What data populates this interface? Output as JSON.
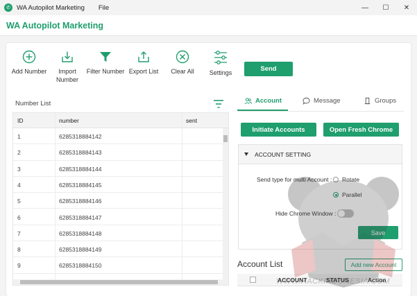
{
  "titlebar": {
    "app_title": "WA Autopilot Marketing",
    "menu_file": "File",
    "minimize": "—",
    "maximize": "☐",
    "close": "✕"
  },
  "header": {
    "title": "WA Autopilot Marketing"
  },
  "toolbar": {
    "add_number": "Add Number",
    "import_number": "Import Number",
    "filter_number": "Filter Number",
    "export_list": "Export List",
    "clear_all": "Clear All",
    "settings": "Settings",
    "send": "Send"
  },
  "number_list": {
    "title": "Number List",
    "columns": [
      "ID",
      "number",
      "sent"
    ],
    "rows": [
      {
        "id": "1",
        "number": "6285318884142",
        "sent": ""
      },
      {
        "id": "2",
        "number": "6285318884143",
        "sent": ""
      },
      {
        "id": "3",
        "number": "6285318884144",
        "sent": ""
      },
      {
        "id": "4",
        "number": "6285318884145",
        "sent": ""
      },
      {
        "id": "5",
        "number": "6285318884146",
        "sent": ""
      },
      {
        "id": "6",
        "number": "6285318884147",
        "sent": ""
      },
      {
        "id": "7",
        "number": "6285318884148",
        "sent": ""
      },
      {
        "id": "8",
        "number": "6285318884149",
        "sent": ""
      },
      {
        "id": "9",
        "number": "6285318884150",
        "sent": ""
      }
    ]
  },
  "tabs": {
    "account": "Account",
    "message": "Message",
    "groups": "Groups"
  },
  "account": {
    "initiate_btn": "Initiate Accounts",
    "fresh_chrome_btn": "Open Fresh Chrome",
    "setting_title": "ACCOUNT SETTING",
    "send_type_label": "Send type for multi Account :",
    "option_rotate": "Rotate",
    "option_parallel": "Parallel",
    "hide_chrome_label": "Hide Chrome Window :",
    "save_btn": "Save",
    "list_title": "Account List",
    "add_account_btn": "Add new Account",
    "columns": [
      "ACCOUNT",
      "STATUS",
      "Action"
    ]
  },
  "watermark": {
    "text": "WWW.HACKINDONESIA.COM"
  },
  "colors": {
    "accent": "#1f9e6e"
  }
}
